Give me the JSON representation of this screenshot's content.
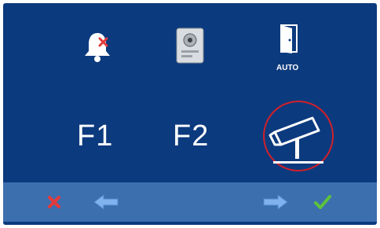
{
  "panel": {
    "auto_label": "AUTO",
    "f1_label": "F1",
    "f2_label": "F2"
  },
  "colors": {
    "background": "#0c3a7e",
    "bar": "#3c6fae",
    "selection": "#d0202a",
    "cancel": "#e33b3b",
    "confirm": "#5cc33a",
    "arrow": "#6fa8e8"
  },
  "icons": {
    "mute": "bell-muted-icon",
    "intercom": "intercom-panel-icon",
    "door": "door-auto-icon",
    "camera": "camera-icon",
    "cancel": "close-icon",
    "back": "arrow-left-icon",
    "forward": "arrow-right-icon",
    "confirm": "check-icon"
  }
}
